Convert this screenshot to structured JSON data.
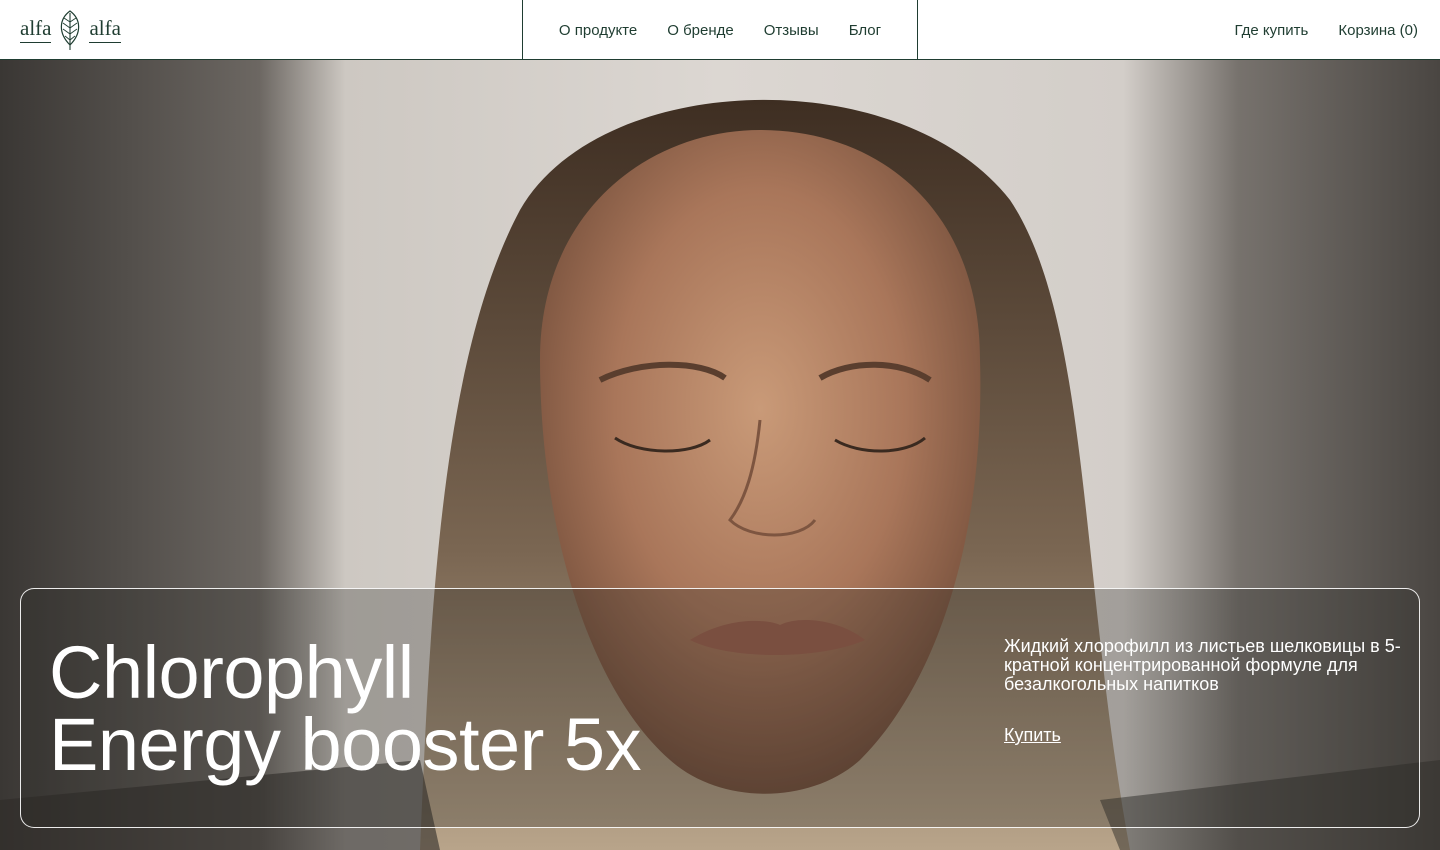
{
  "brand": {
    "logo_left": "alfa",
    "logo_right": "alfa",
    "logo_icon": "leaf-icon",
    "color": "#1f3d31"
  },
  "nav": {
    "items": [
      {
        "label": "О продукте"
      },
      {
        "label": "О бренде"
      },
      {
        "label": "Отзывы"
      },
      {
        "label": "Блог"
      }
    ]
  },
  "header_right": {
    "where_to_buy": "Где купить",
    "cart": "Корзина (0)"
  },
  "hero": {
    "title_line1": "Chlorophyll",
    "title_line2": "Energy booster 5x",
    "description": "Жидкий хлорофилл из листьев шелковицы в 5-кратной концентрированной формуле для безалкогольных напитков",
    "cta": "Купить"
  }
}
